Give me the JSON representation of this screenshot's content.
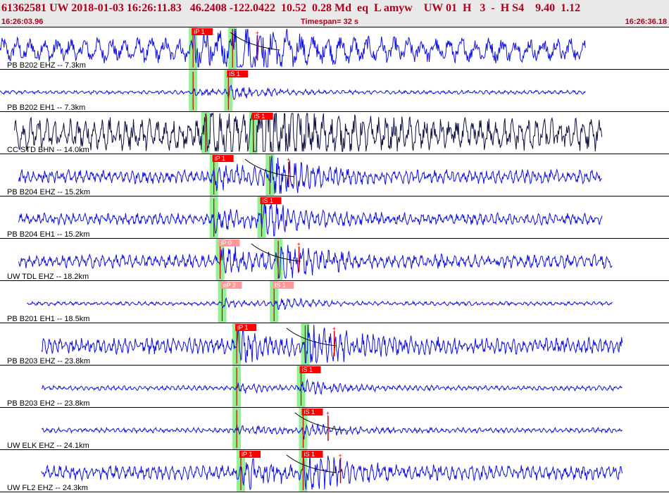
{
  "header": {
    "title": "61362581 UW 2018-01-03 16:26:11.83   46.2408 -122.0422  10.52  0.28 Md  eq  L amyw    UW 01  H   3  -  H S4    9.40  1.12",
    "start_time": "16:26:03.96",
    "timespan": "Timespan=  32 s",
    "end_time": "16:26:36.18"
  },
  "colors": {
    "trace": "#1010e0",
    "trace_dark": "#101040",
    "pick_box": "#ff0000",
    "pick_box_light": "#ff9999",
    "highlight": "#80ee80",
    "pick_line": "#cc0000",
    "title": "#b0001c"
  },
  "chart_data": {
    "type": "line",
    "x_unit": "s",
    "xlim": [
      0,
      32.22
    ],
    "start_time": "16:26:03.96",
    "end_time": "16:26:36.18",
    "timespan_s": 32,
    "stations": [
      {
        "label": "PB B202 EHZ -- 7.3km",
        "start": 0.0,
        "end": 28.2,
        "amp": 0.26,
        "period": 0.65,
        "dark": false,
        "p": 9.3,
        "s": 11.2,
        "p_label": "iP 1",
        "s_label": "",
        "p_light": false,
        "s_light": false,
        "coda": 11.1,
        "tick": 12.4
      },
      {
        "label": "PB B202 EH1 -- 7.3km",
        "start": 0.0,
        "end": 28.2,
        "amp": 0.04,
        "period": 0.3,
        "dark": false,
        "p": 9.3,
        "s": 11.0,
        "p_label": "",
        "s_label": "iS 1",
        "p_light": false,
        "s_light": false,
        "coda": null,
        "tick": null
      },
      {
        "label": "CC STD BHN -- 14.0km",
        "start": 0.7,
        "end": 29.0,
        "amp": 0.34,
        "period": 0.38,
        "dark": true,
        "p": 9.9,
        "s": 12.2,
        "p_label": "",
        "s_label": "iS 1",
        "p_light": false,
        "s_light": false,
        "coda": null,
        "tick": null
      },
      {
        "label": "PB B204 EHZ -- 15.2km",
        "start": 0.9,
        "end": 29.0,
        "amp": 0.14,
        "period": 0.28,
        "dark": false,
        "p": 10.3,
        "s": 13.0,
        "p_label": "iP 1",
        "s_label": "",
        "p_light": false,
        "s_light": false,
        "coda": 11.8,
        "tick": 13.9
      },
      {
        "label": "PB B204 EH1 -- 15.2km",
        "start": 0.9,
        "end": 29.0,
        "amp": 0.12,
        "period": 0.28,
        "dark": false,
        "p": 10.3,
        "s": 12.6,
        "p_label": "",
        "s_label": "iS 1",
        "p_light": false,
        "s_light": false,
        "coda": null,
        "tick": null
      },
      {
        "label": "UW TDL EHZ -- 18.2km",
        "start": 0.9,
        "end": 29.5,
        "amp": 0.14,
        "period": 0.32,
        "dark": false,
        "p": 10.6,
        "s": 13.4,
        "p_label": "iP 0",
        "s_label": "",
        "p_light": true,
        "s_light": false,
        "coda": 12.1,
        "tick": 14.4
      },
      {
        "label": "PB B201 EH1 -- 18.5km",
        "start": 1.3,
        "end": 29.5,
        "amp": 0.04,
        "period": 0.3,
        "dark": false,
        "p": 10.7,
        "s": 13.2,
        "p_label": "eP 2",
        "s_label": "iS 1",
        "p_light": true,
        "s_light": true,
        "coda": null,
        "tick": null
      },
      {
        "label": "PB B203 EHZ -- 23.8km",
        "start": 2.0,
        "end": 30.0,
        "amp": 0.17,
        "period": 0.26,
        "dark": false,
        "p": 11.4,
        "s": 14.7,
        "p_label": "iP 1",
        "s_label": "",
        "p_light": false,
        "s_light": false,
        "coda": 13.8,
        "tick": 16.1
      },
      {
        "label": "PB B203 EH2 -- 23.8km",
        "start": 2.0,
        "end": 30.0,
        "amp": 0.05,
        "period": 0.26,
        "dark": false,
        "p": 11.4,
        "s": 14.5,
        "p_label": "",
        "s_label": "iS 1",
        "p_light": false,
        "s_light": false,
        "coda": null,
        "tick": null
      },
      {
        "label": "UW ELK EHZ -- 24.1km",
        "start": 2.0,
        "end": 30.0,
        "amp": 0.05,
        "period": 0.26,
        "dark": false,
        "p": 11.4,
        "s": 14.6,
        "p_label": "",
        "s_label": "iS 1",
        "p_light": false,
        "s_light": false,
        "coda": 14.2,
        "tick": 15.8
      },
      {
        "label": "UW FL2 EHZ -- 24.3km",
        "start": 2.0,
        "end": 30.0,
        "amp": 0.15,
        "period": 0.3,
        "dark": false,
        "p": 11.6,
        "s": 14.6,
        "p_label": "iP 1",
        "s_label": "iS 1",
        "p_light": false,
        "s_light": false,
        "coda": 13.8,
        "tick": 16.4
      }
    ]
  }
}
